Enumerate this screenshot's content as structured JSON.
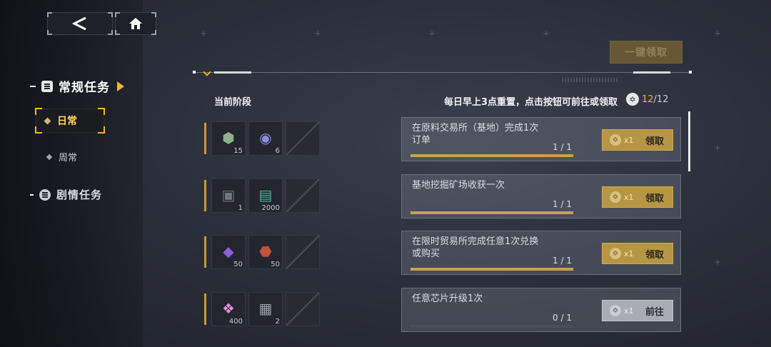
{
  "topbar": {
    "back_icon": "back-arrow-icon",
    "home_icon": "home-icon"
  },
  "sidebar": {
    "categories": [
      {
        "label": "常规任务",
        "active": true
      },
      {
        "label": "剧情任务",
        "active": false
      }
    ],
    "subitems": [
      {
        "label": "日常",
        "active": true
      },
      {
        "label": "周常",
        "active": false
      }
    ]
  },
  "header": {
    "claim_all": "一键领取",
    "stage_label": "当前阶段",
    "reset_text": "每日早上3点重置，点击按钮可前往或领取",
    "progress_done": "12",
    "progress_total": "/12"
  },
  "colors": {
    "accent": "#f5b81c",
    "claim_button": "#b69645",
    "go_button": "#a9acb3"
  },
  "tasks": [
    {
      "text": "在原料交易所（基地）完成1次订单",
      "progress": "1 / 1",
      "progress_value": 1.0,
      "rewards": [
        {
          "icon": "material-box-icon",
          "qty": "15"
        },
        {
          "icon": "lens-disc-icon",
          "qty": "6"
        },
        {
          "icon": "empty-slot",
          "qty": ""
        }
      ],
      "button": {
        "token": "x1",
        "label": "领取"
      }
    },
    {
      "text": "基地挖掘矿场收获一次",
      "progress": "1 / 1",
      "progress_value": 1.0,
      "rewards": [
        {
          "icon": "tech-crate-icon",
          "qty": "1"
        },
        {
          "icon": "exp-card-icon",
          "qty": "2000"
        },
        {
          "icon": "empty-slot",
          "qty": ""
        }
      ],
      "button": {
        "token": "x1",
        "label": "领取"
      }
    },
    {
      "text": "在限时贸易所完成任意1次兑换或购买",
      "progress": "1 / 1",
      "progress_value": 1.0,
      "rewards": [
        {
          "icon": "purple-crystal-icon",
          "qty": "50"
        },
        {
          "icon": "red-ore-icon",
          "qty": "50"
        },
        {
          "icon": "empty-slot",
          "qty": ""
        }
      ],
      "button": {
        "token": "x1",
        "label": "领取"
      }
    },
    {
      "text": "任意芯片升级1次",
      "progress": "0 / 1",
      "progress_value": 0.0,
      "rewards": [
        {
          "icon": "pink-crystal-icon",
          "qty": "400"
        },
        {
          "icon": "chip-01-icon",
          "qty": "2"
        },
        {
          "icon": "empty-slot",
          "qty": ""
        }
      ],
      "button": {
        "token": "x1",
        "label": "前往"
      }
    }
  ]
}
